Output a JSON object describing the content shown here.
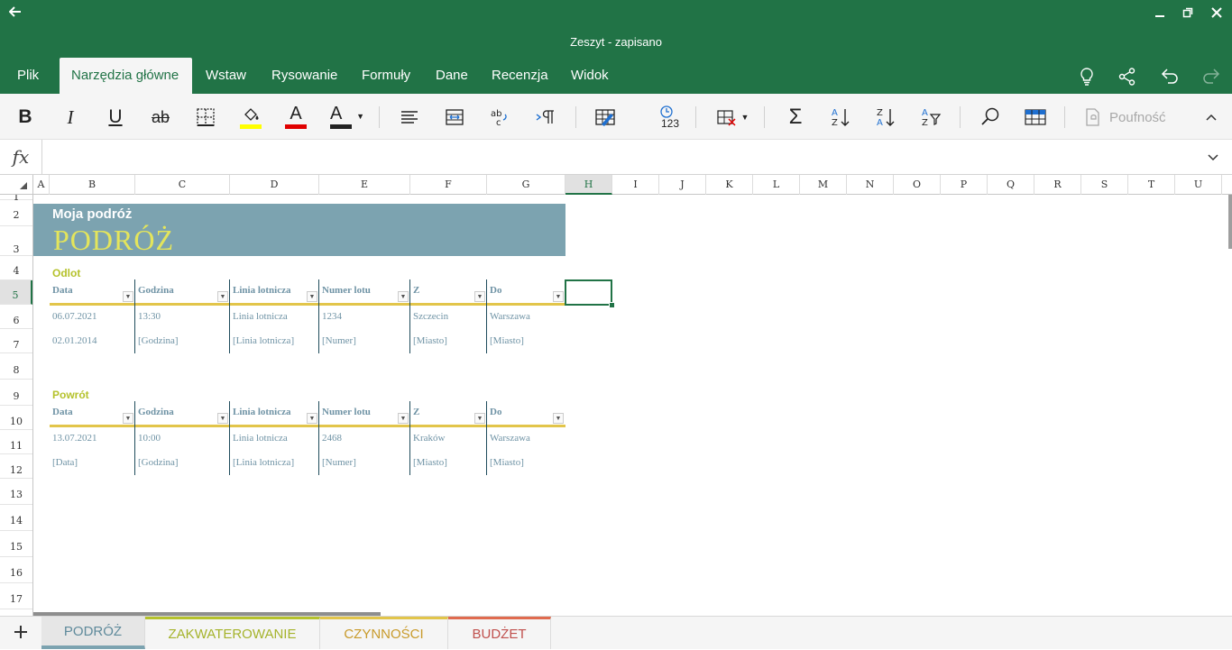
{
  "app": {
    "title": "Zeszyt - zapisano",
    "accent": "#217346"
  },
  "tabs": [
    "Plik",
    "Narzędzia główne",
    "Wstaw",
    "Rysowanie",
    "Formuły",
    "Dane",
    "Recenzja",
    "Widok"
  ],
  "active_tab": "Narzędzia główne",
  "ribbon": {
    "bold": "B",
    "italic": "I",
    "underline": "U",
    "strike": "ab",
    "font_color_letter": "A",
    "font_color_letter2": "A",
    "sensitivity_label": "Poufność",
    "number_format_label": "123",
    "fill_color": "#ffff00",
    "font_color": "#e00000",
    "font_color2": "#222222"
  },
  "formula_bar": {
    "fx": "fx",
    "value": ""
  },
  "columns": [
    "A",
    "B",
    "C",
    "D",
    "E",
    "F",
    "G",
    "H",
    "I",
    "J",
    "K",
    "L",
    "M",
    "N",
    "O",
    "P",
    "Q",
    "R",
    "S",
    "T",
    "U"
  ],
  "selected_column": "H",
  "rows": [
    "1",
    "2",
    "3",
    "4",
    "5",
    "6",
    "7",
    "8",
    "9",
    "10",
    "11",
    "12",
    "13",
    "14",
    "15",
    "16",
    "17"
  ],
  "selected_row": "5",
  "sheet": {
    "subtitle": "Moja podróż",
    "title": "PODRÓŻ",
    "departure": {
      "label": "Odlot",
      "headers": [
        "Data",
        "Godzina",
        "Linia lotnicza",
        "Numer lotu",
        "Z",
        "Do"
      ],
      "rows": [
        [
          "06.07.2021",
          "13:30",
          "Linia lotnicza",
          "1234",
          "Szczecin",
          "Warszawa"
        ],
        [
          "02.01.2014",
          "[Godzina]",
          "[Linia lotnicza]",
          "[Numer]",
          "[Miasto]",
          "[Miasto]"
        ]
      ]
    },
    "return": {
      "label": "Powrót",
      "headers": [
        "Data",
        "Godzina",
        "Linia lotnicza",
        "Numer lotu",
        "Z",
        "Do"
      ],
      "rows": [
        [
          "13.07.2021",
          "10:00",
          "Linia lotnicza",
          "2468",
          "Kraków",
          "Warszawa"
        ],
        [
          "[Data]",
          "[Godzina]",
          "[Linia lotnicza]",
          "[Numer]",
          "[Miasto]",
          "[Miasto]"
        ]
      ]
    }
  },
  "sheet_tabs": [
    {
      "label": "PODRÓŻ",
      "color": "#5f8a9b",
      "active": true
    },
    {
      "label": "ZAKWATEROWANIE",
      "color": "#a5b32b",
      "active": false
    },
    {
      "label": "CZYNNOŚCI",
      "color": "#c89a2a",
      "active": false
    },
    {
      "label": "BUDŻET",
      "color": "#c0504d",
      "active": false
    }
  ],
  "icons": [
    "back-icon",
    "minimize-icon",
    "restore-icon",
    "close-icon",
    "lightbulb-icon",
    "share-icon",
    "undo-icon",
    "redo-icon"
  ]
}
